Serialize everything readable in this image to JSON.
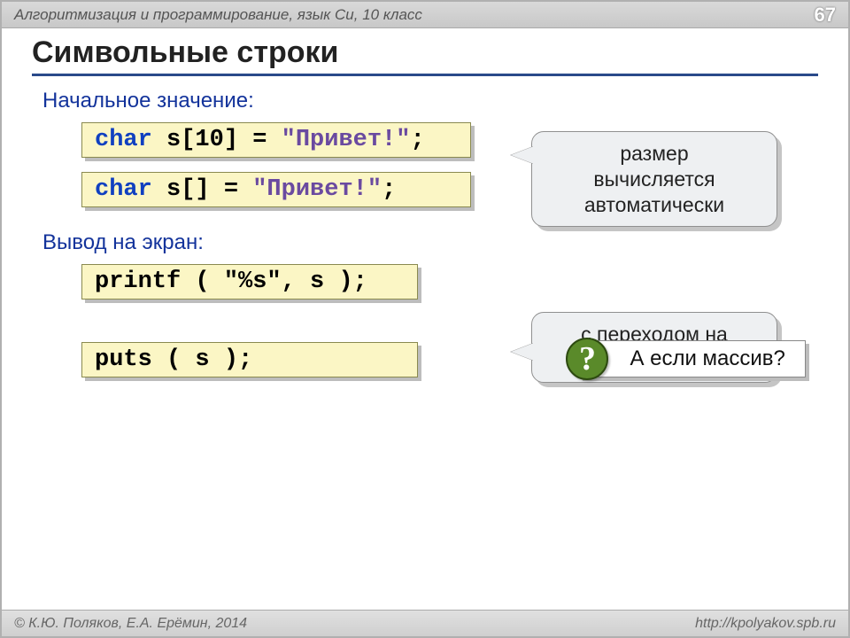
{
  "header": {
    "course": "Алгоритмизация и программирование, язык Си, 10 класс",
    "page": "67"
  },
  "title": "Символьные строки",
  "section1": {
    "label": "Начальное значение:",
    "code1": {
      "kw": "char",
      "rest": " s[10] = ",
      "str": "\"Привет!\"",
      "end": ";"
    },
    "code2": {
      "kw": "char",
      "rest": " s[] = ",
      "str": "\"Привет!\"",
      "end": ";"
    }
  },
  "callout1": "размер\nвычисляется\nавтоматически",
  "section2": {
    "label": "Вывод на экран:",
    "code1": {
      "text": "printf ( \"%s\", s );"
    },
    "code2": {
      "text": "puts ( s );"
    }
  },
  "callout2": "с переходом на\nновую строку",
  "question": "А если массив?",
  "qmark": "?",
  "footer": {
    "copyright": "© К.Ю. Поляков, Е.А. Ерёмин, 2014",
    "url": "http://kpolyakov.spb.ru"
  }
}
